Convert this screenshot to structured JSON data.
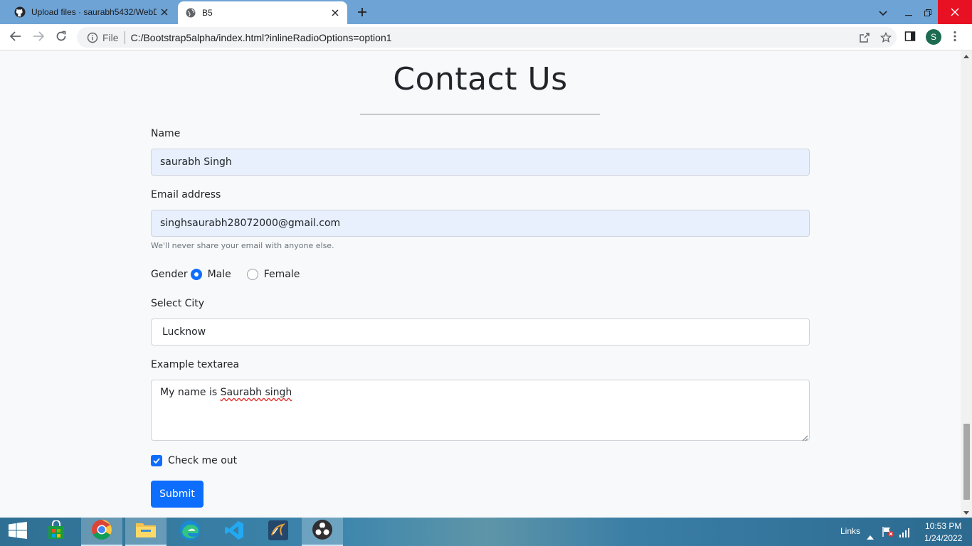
{
  "browser": {
    "tabs": [
      {
        "title": "Upload files · saurabh5432/WebD",
        "active": false,
        "icon": "github-icon"
      },
      {
        "title": "B5",
        "active": true,
        "icon": "globe-icon"
      }
    ],
    "address": {
      "scheme_label": "File",
      "url": "C:/Bootstrap5alpha/index.html?inlineRadioOptions=option1"
    },
    "profile_initial": "S"
  },
  "page": {
    "title": "Contact Us",
    "form": {
      "name_label": "Name",
      "name_value": "saurabh Singh",
      "email_label": "Email address",
      "email_value": "singhsaurabh28072000@gmail.com",
      "email_help": "We'll never share your email with anyone else.",
      "gender_label": "Gender",
      "gender_options": [
        {
          "label": "Male",
          "checked": true
        },
        {
          "label": "Female",
          "checked": false
        }
      ],
      "city_label": "Select City",
      "city_value": "Lucknow",
      "textarea_label": "Example textarea",
      "textarea_prefix": "My name is ",
      "textarea_misspelled": "Saurabh singh",
      "check_label": "Check me out",
      "check_checked": true,
      "submit_label": "Submit"
    }
  },
  "taskbar": {
    "apps": [
      "windows-start-icon",
      "store-icon",
      "chrome-icon",
      "file-explorer-icon",
      "edge-icon",
      "vscode-icon",
      "mysql-workbench-icon",
      "obs-icon"
    ],
    "active_app": "obs-icon",
    "links_label": "Links",
    "time": "10:53 PM",
    "date": "1/24/2022"
  },
  "colors": {
    "tab_strip": "#6ea3d6",
    "primary": "#0d6efd",
    "autofill": "#e8f0fe",
    "page_bg": "#f8f9fa"
  }
}
